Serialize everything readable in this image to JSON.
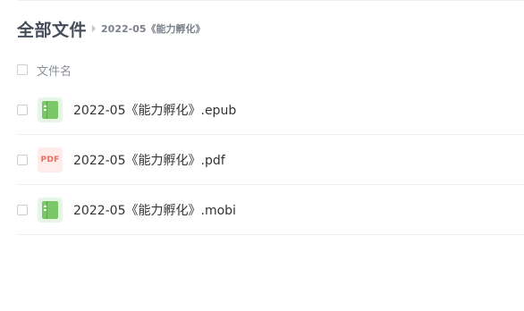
{
  "breadcrumb": {
    "root": "全部文件",
    "current": "2022-05《能力孵化》"
  },
  "list_header": {
    "name_label": "文件名"
  },
  "files": [
    {
      "name": "2022-05《能力孵化》.epub",
      "icon": "ebook-icon"
    },
    {
      "name": "2022-05《能力孵化》.pdf",
      "icon": "pdf-icon",
      "icon_text": "PDF"
    },
    {
      "name": "2022-05《能力孵化》.mobi",
      "icon": "ebook-icon"
    }
  ],
  "colors": {
    "ebook_icon": "#7bc767",
    "pdf_icon": "#f26b5b"
  }
}
